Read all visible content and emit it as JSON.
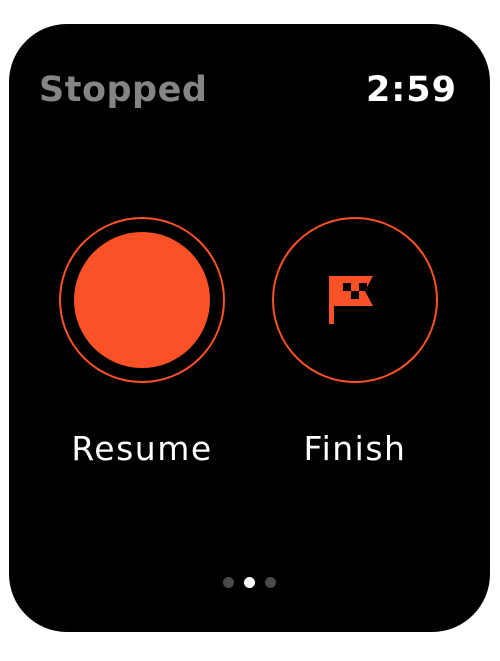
{
  "header": {
    "status": "Stopped",
    "time": "2:59"
  },
  "controls": {
    "resume": {
      "label": "Resume",
      "icon": "record-circle-icon"
    },
    "finish": {
      "label": "Finish",
      "icon": "checkered-flag-icon"
    }
  },
  "pager": {
    "count": 3,
    "active_index": 1
  },
  "colors": {
    "accent": "#fa5127",
    "status_text": "#858585",
    "background": "#000000",
    "dot_inactive": "#4a4a4a"
  }
}
